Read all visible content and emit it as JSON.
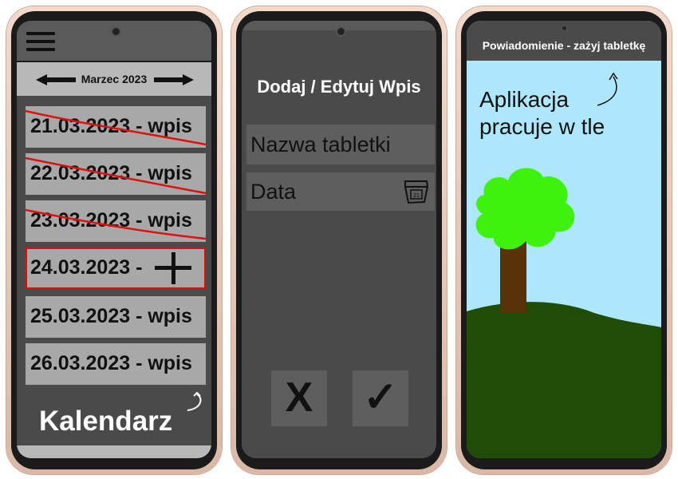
{
  "phone1": {
    "menu_icon": "hamburger-icon",
    "month": "Marzec 2023",
    "entries": [
      {
        "date": "21.03.2023 - wpis",
        "crossed": true
      },
      {
        "date": "22.03.2023 - wpis",
        "crossed": true
      },
      {
        "date": "23.03.2023 - wpis",
        "crossed": true
      },
      {
        "date": "24.03.2023 -",
        "crossed": false,
        "active": true
      },
      {
        "date": "25.03.2023 - wpis",
        "crossed": false
      },
      {
        "date": "26.03.2023 - wpis",
        "crossed": false
      }
    ],
    "caption": "Kalendarz"
  },
  "phone2": {
    "title": "Dodaj / Edytuj Wpis",
    "field_name": "Nazwa tabletki",
    "field_date": "Data",
    "cancel_label": "X",
    "confirm_label": "✓"
  },
  "phone3": {
    "notification": "Powiadomienie - zażyj tabletkę",
    "background_text_line1": "Aplikacja",
    "background_text_line2": "pracuje w tle"
  },
  "colors": {
    "phone_body": "#e8c9b8",
    "screen_dark": "#4a4a4a",
    "item_grey": "#a8a8a8",
    "strike_red": "#e01010",
    "sky": "#aee6fb",
    "grass": "#1f4d05",
    "trunk": "#5a3108",
    "leaves": "#3ef20e"
  }
}
